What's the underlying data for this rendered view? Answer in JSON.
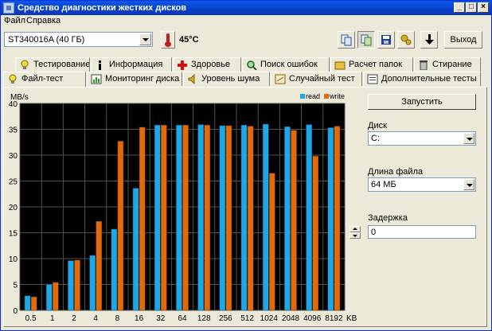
{
  "window": {
    "title": "Средство диагностики жестких дисков"
  },
  "menu": [
    "Файл",
    "Справка"
  ],
  "toolbar": {
    "drive": "ST340016A (40 ГБ)",
    "temperature": "45°C",
    "exit_label": "Выход",
    "buttons": [
      "copy-icon",
      "copy-active-icon",
      "save-icon",
      "settings-icon",
      "down-arrow-icon"
    ]
  },
  "tabs_row1": [
    {
      "label": "Тестирование",
      "icon": "bulb-icon"
    },
    {
      "label": "Информация",
      "icon": "info-icon"
    },
    {
      "label": "Здоровье",
      "icon": "health-cross-icon"
    },
    {
      "label": "Поиск ошибок",
      "icon": "magnifier-icon"
    },
    {
      "label": "Расчет папок",
      "icon": "folder-icon"
    },
    {
      "label": "Стирание",
      "icon": "trash-icon"
    }
  ],
  "tabs_row2": [
    {
      "label": "Файл-тест",
      "icon": "file-test-icon",
      "active": true
    },
    {
      "label": "Мониторинг диска",
      "icon": "monitor-chart-icon"
    },
    {
      "label": "Уровень шума",
      "icon": "speaker-icon"
    },
    {
      "label": "Случайный тест",
      "icon": "random-icon"
    },
    {
      "label": "Дополнительные тесты",
      "icon": "extra-tests-icon"
    }
  ],
  "side": {
    "run_label": "Запустить",
    "disk_label": "Диск",
    "disk_value": "C:",
    "file_length_label": "Длина файла",
    "file_length_value": "64 МБ",
    "delay_label": "Задержка",
    "delay_value": "0"
  },
  "colors": {
    "read": "#1ea8e6",
    "write": "#e06a0c",
    "plot_bg": "#000000",
    "grid": "#505050"
  },
  "chart_data": {
    "type": "bar",
    "ylabel": "MB/s",
    "xunit": "KB",
    "ylim": [
      0,
      40
    ],
    "yticks": [
      0,
      5,
      10,
      15,
      20,
      25,
      30,
      35,
      40
    ],
    "categories": [
      "0.5",
      "1",
      "2",
      "4",
      "8",
      "16",
      "32",
      "64",
      "128",
      "256",
      "512",
      "1024",
      "2048",
      "4096",
      "8192"
    ],
    "series": [
      {
        "name": "read",
        "values": [
          2.8,
          5.0,
          9.6,
          10.6,
          15.7,
          23.6,
          35.8,
          35.8,
          35.9,
          35.7,
          35.8,
          36.0,
          35.5,
          35.9,
          35.3
        ]
      },
      {
        "name": "write",
        "values": [
          2.6,
          5.4,
          9.7,
          17.2,
          32.7,
          35.4,
          35.8,
          35.8,
          35.8,
          35.7,
          35.6,
          26.5,
          34.8,
          29.8,
          35.6
        ]
      }
    ],
    "legend": "top-right",
    "grid": true
  }
}
